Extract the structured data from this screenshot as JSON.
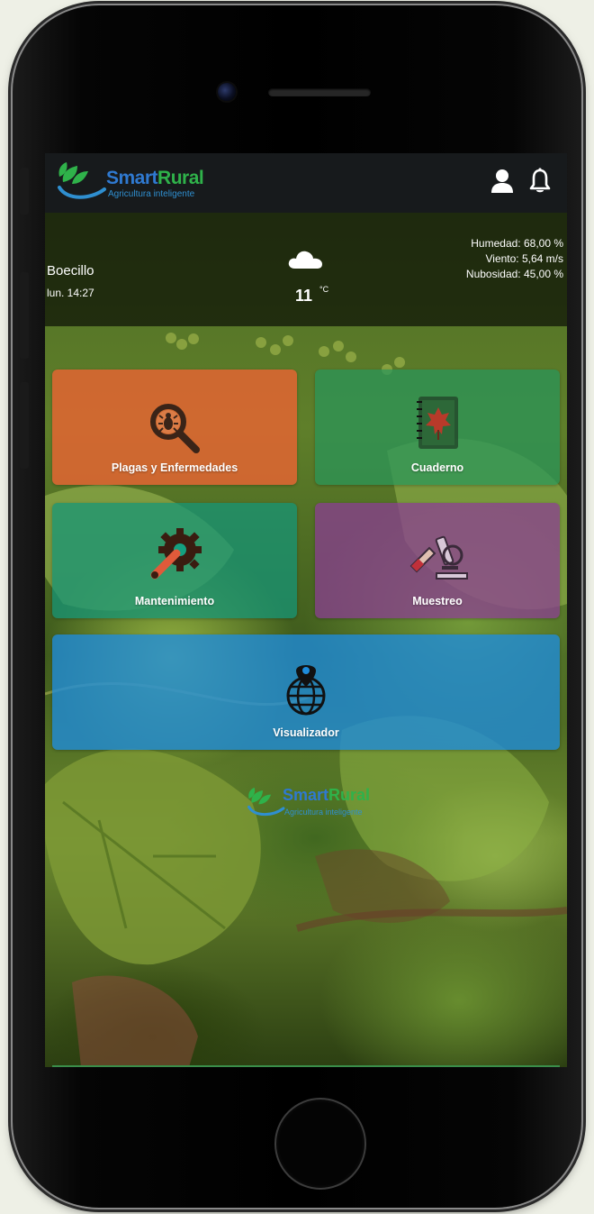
{
  "header": {
    "logo": {
      "word_smart": "Smart",
      "word_rural": "Rural",
      "tagline": "Agricultura inteligente"
    }
  },
  "weather": {
    "location": "Boecillo",
    "time": "lun. 14:27",
    "temperature": "11",
    "unit": "°C",
    "humidity": "Humedad: 68,00 %",
    "wind": "Viento: 5,64 m/s",
    "cloudiness": "Nubosidad: 45,00 %"
  },
  "tiles": {
    "plagas": {
      "label": "Plagas y Enfermedades",
      "color": "#e8643a"
    },
    "cuaderno": {
      "label": "Cuaderno",
      "color": "#28965a"
    },
    "mantenimiento": {
      "label": "Mantenimiento",
      "color": "#149678"
    },
    "muestreo": {
      "label": "Muestreo",
      "color": "#8c3c96"
    },
    "visualizador": {
      "label": "Visualizador",
      "color": "#1e8cdc"
    }
  },
  "footer_logo": {
    "word_smart": "Smart",
    "word_rural": "Rural",
    "tagline": "Agricultura inteligente"
  },
  "icons": {
    "user": "user-icon",
    "bell": "bell-icon",
    "cloud": "cloud-icon",
    "plagas": "magnifier-bug-icon",
    "cuaderno": "notebook-leaf-icon",
    "mantenimiento": "wrench-gear-icon",
    "muestreo": "microscope-icon",
    "visualizador": "globe-pin-icon"
  }
}
